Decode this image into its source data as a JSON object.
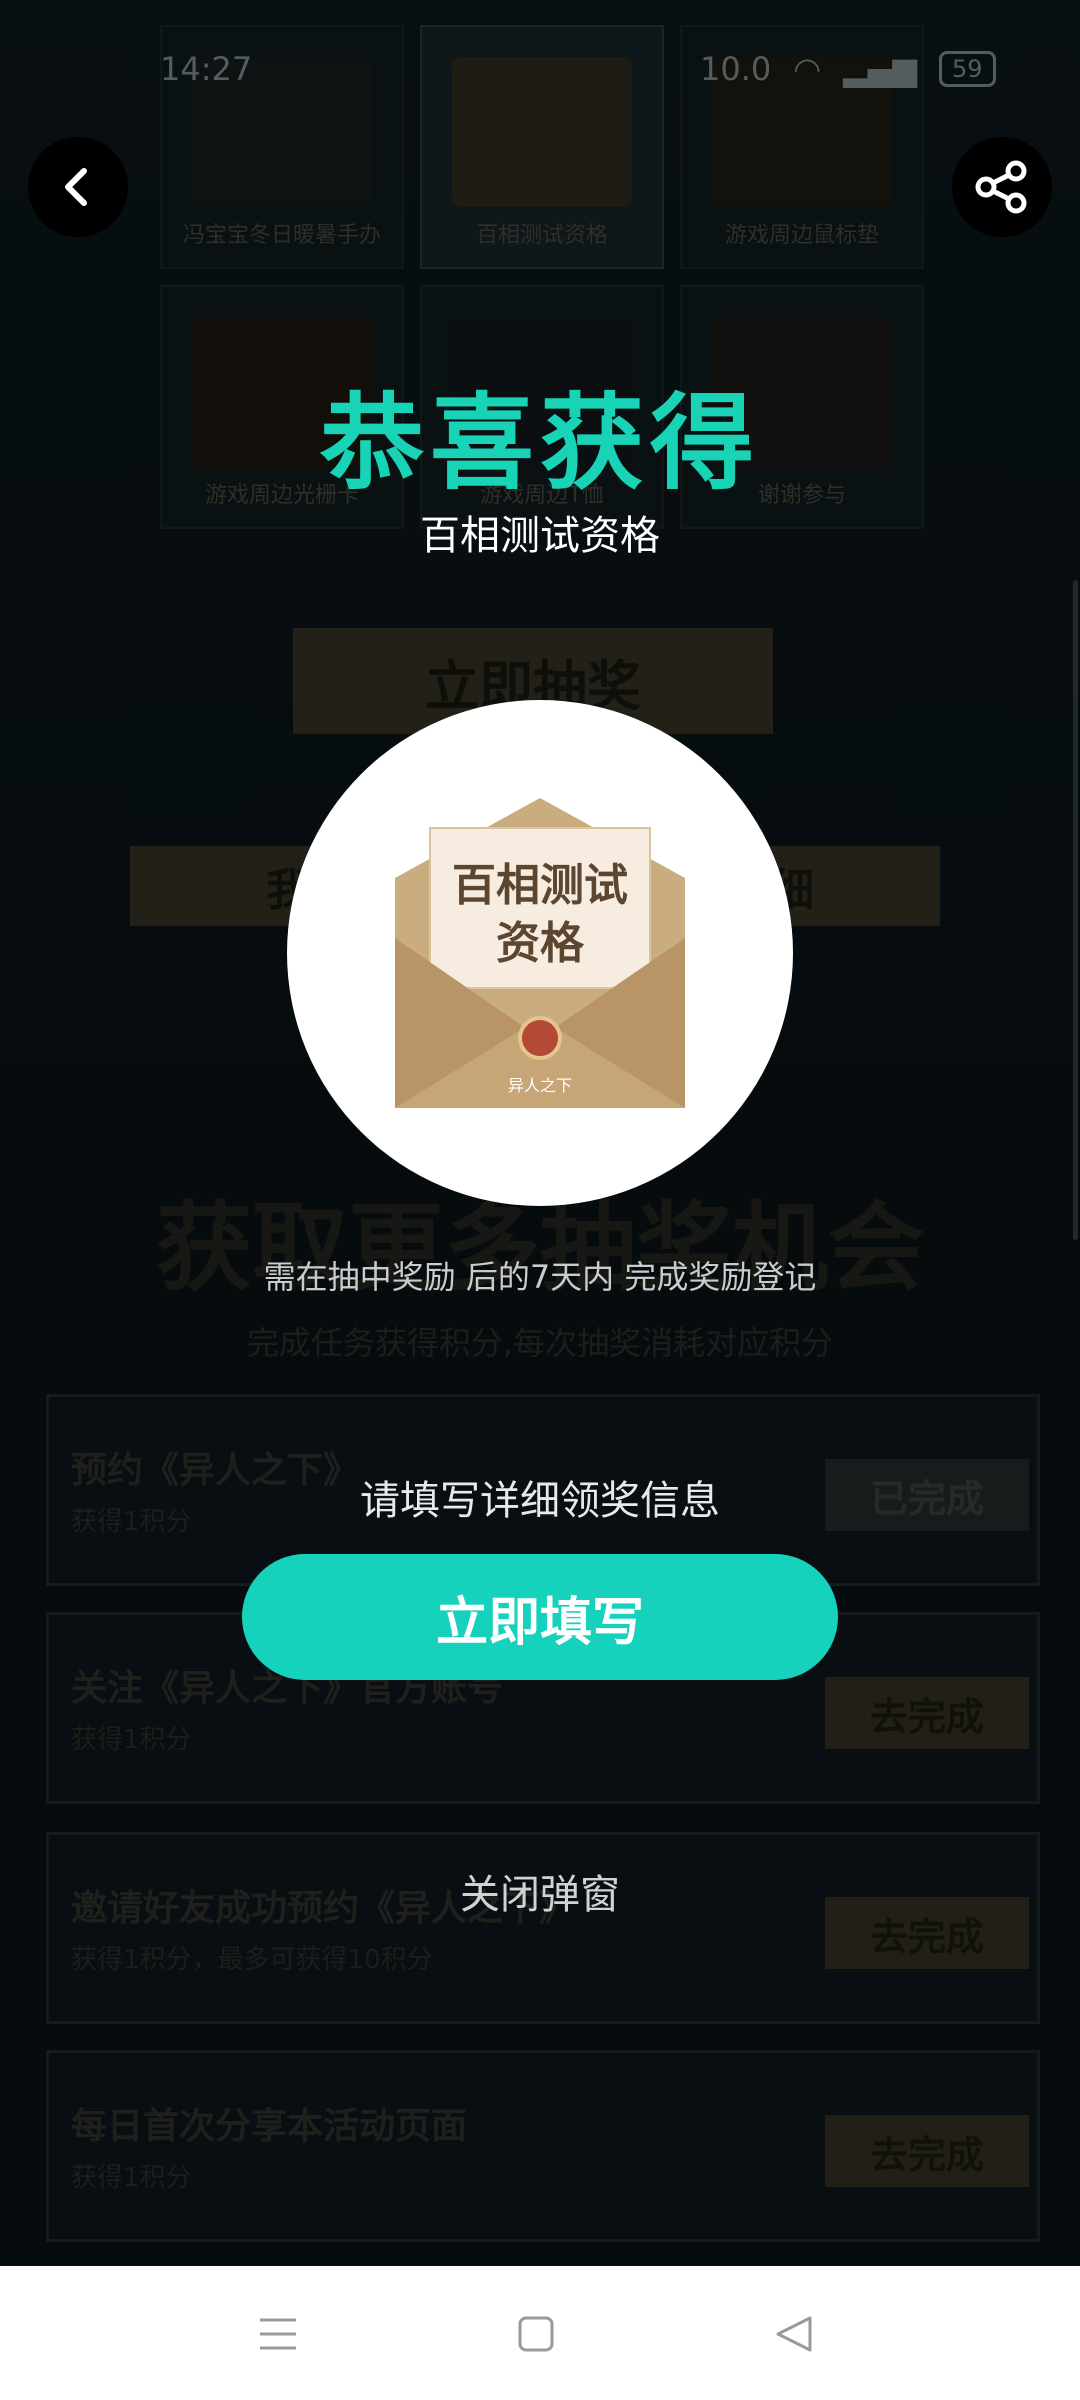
{
  "status_bar": {
    "time": "14:27",
    "network": "10.0",
    "battery": "59"
  },
  "top_bar": {
    "back_icon": "chevron-left-icon",
    "share_icon": "share-icon"
  },
  "prize_grid": [
    {
      "label": "冯宝宝冬日暖暑手办",
      "selected": false
    },
    {
      "label": "百相测试资格",
      "selected": true
    },
    {
      "label": "游戏周边鼠标垫",
      "selected": false
    },
    {
      "label": "游戏周边光栅卡",
      "selected": false
    },
    {
      "label": "游戏周边T恤",
      "selected": false
    },
    {
      "label": "谢谢参与",
      "selected": false
    }
  ],
  "draw_button": "立即抽奖",
  "my_prizes_button": "我的",
  "points_detail_button": "明细",
  "section": {
    "title": "获取更多抽奖机会",
    "subtitle": "完成任务获得积分,每次抽奖消耗对应积分"
  },
  "tasks": [
    {
      "name": "预约《异人之下》",
      "desc": "获得1积分",
      "button": "已完成",
      "done": true
    },
    {
      "name": "关注《异人之下》官方账号",
      "desc": "获得1积分",
      "button": "去完成",
      "done": false
    },
    {
      "name": "邀请好友成功预约《异人之下》",
      "desc": "获得1积分，最多可获得10积分",
      "button": "去完成",
      "done": false
    },
    {
      "name": "每日首次分享本活动页面",
      "desc": "获得1积分",
      "button": "去完成",
      "done": false
    }
  ],
  "modal": {
    "title": "恭喜获得",
    "prize_name": "百相测试资格",
    "prize_card": {
      "line1": "百相测试",
      "line2": "资格",
      "footer": "异人之下"
    },
    "note": "需在抽中奖励 后的7天内 完成奖励登记",
    "fill_hint": "请填写详细领奖信息",
    "fill_button": "立即填写",
    "close_button": "关闭弹窗"
  },
  "colors": {
    "accent": "#16d1bb",
    "gold": "#3f3b2a"
  }
}
